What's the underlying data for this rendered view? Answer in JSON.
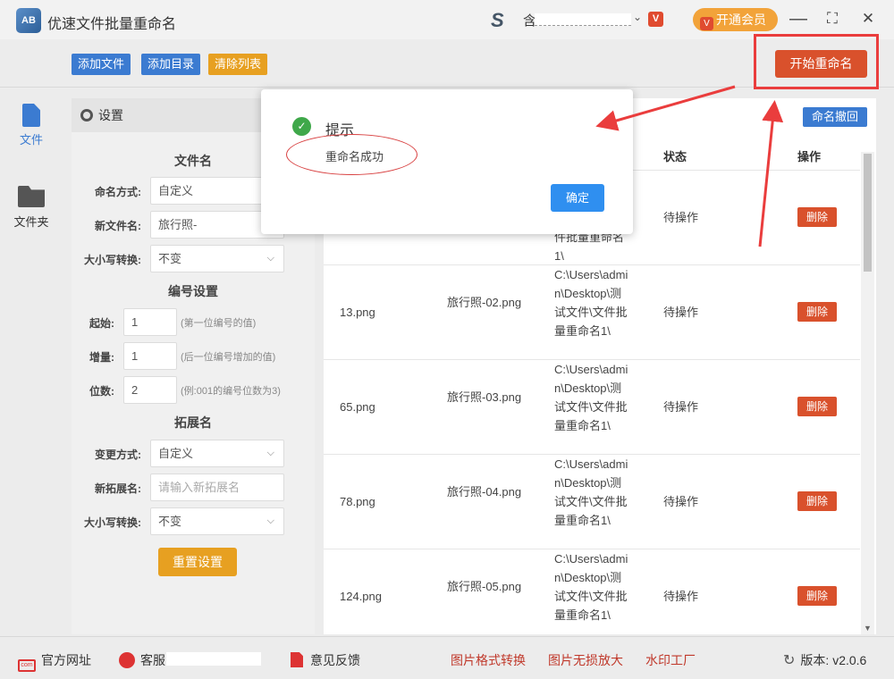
{
  "titlebar": {
    "logo_text": "AB",
    "title": "优速文件批量重命名",
    "user_logo": "S",
    "user_prefix": "含",
    "vip_label": "开通会员",
    "vip_icon": "V",
    "minimize": "—",
    "maximize": "⛶",
    "close": "✕"
  },
  "toolbar": {
    "add_file": "添加文件",
    "add_dir": "添加目录",
    "clear_list": "清除列表",
    "start": "开始重命名"
  },
  "sidebar": {
    "items": [
      {
        "label": "文件",
        "icon": "file-icon"
      },
      {
        "label": "文件夹",
        "icon": "folder-icon"
      }
    ]
  },
  "settings": {
    "header": "设置",
    "filename_section": "文件名",
    "naming_mode_label": "命名方式:",
    "naming_mode_value": "自定义",
    "new_name_label": "新文件名:",
    "new_name_value": "旅行照-",
    "case_label": "大小写转换:",
    "case_value": "不变",
    "number_section": "编号设置",
    "start_label": "起始:",
    "start_value": "1",
    "start_hint": "(第一位编号的值)",
    "inc_label": "增量:",
    "inc_value": "1",
    "inc_hint": "(后一位编号增加的值)",
    "digits_label": "位数:",
    "digits_value": "2",
    "digits_hint": "(例:001的编号位数为3)",
    "ext_section": "拓展名",
    "change_mode_label": "变更方式:",
    "change_mode_value": "自定义",
    "new_ext_label": "新拓展名:",
    "new_ext_placeholder": "请输入新拓展名",
    "ext_case_label": "大小写转换:",
    "ext_case_value": "不变",
    "reset": "重置设置"
  },
  "table": {
    "undo": "命名撤回",
    "headers": {
      "status": "状态",
      "action": "操作"
    },
    "first_row": {
      "path_tail": "件批量重命名\n1\\",
      "status": "待操作",
      "action": "删除"
    },
    "rows": [
      {
        "name": "13.png",
        "new_name": "旅行照-02.png",
        "path": "C:\\Users\\admin\\Desktop\\测试文件\\文件批量重命名1\\",
        "status": "待操作",
        "action": "删除"
      },
      {
        "name": "65.png",
        "new_name": "旅行照-03.png",
        "path": "C:\\Users\\admin\\Desktop\\测试文件\\文件批量重命名1\\",
        "status": "待操作",
        "action": "删除"
      },
      {
        "name": "78.png",
        "new_name": "旅行照-04.png",
        "path": "C:\\Users\\admin\\Desktop\\测试文件\\文件批量重命名1\\",
        "status": "待操作",
        "action": "删除"
      },
      {
        "name": "124.png",
        "new_name": "旅行照-05.png",
        "path": "C:\\Users\\admin\\Desktop\\测试文件\\文件批量重命名1\\",
        "status": "待操作",
        "action": "删除"
      }
    ]
  },
  "modal": {
    "title": "提示",
    "message": "重命名成功",
    "ok": "确定",
    "icon": "check-icon"
  },
  "footer": {
    "website": "官方网址",
    "support": "客服",
    "feedback": "意见反馈",
    "img_convert": "图片格式转换",
    "img_enlarge": "图片无损放大",
    "watermark": "水印工厂",
    "version_label": "版本:",
    "version": "v2.0.6"
  },
  "colors": {
    "primary_blue": "#3b7bd1",
    "accent_orange": "#e7a021",
    "danger_red": "#d9512c",
    "annotation_red": "#ea3d3d",
    "success_green": "#3fa84a"
  }
}
